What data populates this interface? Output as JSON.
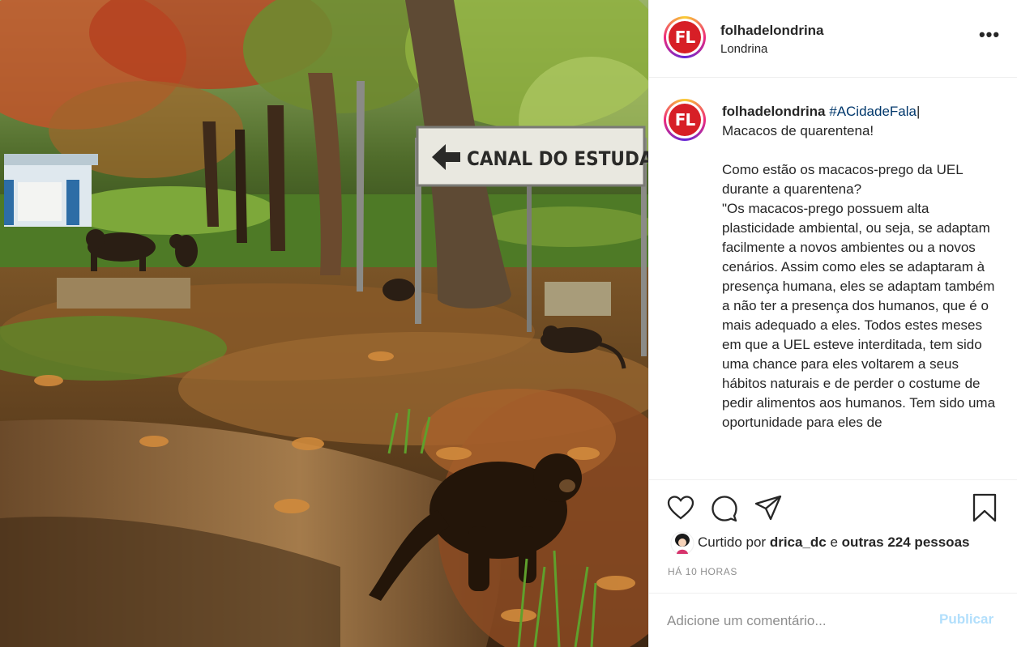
{
  "post": {
    "username": "folhadelondrina",
    "location": "Londrina",
    "avatar_text": "FL",
    "more_label": "•••"
  },
  "photo": {
    "sign_text": "CANAL DO ESTUDANTE"
  },
  "caption": {
    "username": "folhadelondrina",
    "hashtag": "#ACidadeFala",
    "cursor": "|",
    "text": "Macacos de quarentena!\n\nComo estão os macacos-prego da UEL durante a quarentena?\n\"Os macacos-prego possuem alta plasticidade ambiental, ou seja, se adaptam facilmente a novos ambientes ou a novos cenários. Assim como eles se adaptaram à presença humana, eles se adaptam também a não ter a presença dos humanos, que é o mais adequado a eles. Todos estes meses em que a UEL esteve interditada, tem sido uma chance para eles voltarem a seus hábitos naturais e de perder o costume de pedir alimentos aos humanos. Tem sido uma oportunidade para eles de"
  },
  "likes": {
    "prefix": "Curtido por ",
    "user": "drica_dc",
    "middle": " e ",
    "others": "outras 224 pessoas"
  },
  "timestamp": "HÁ 10 HORAS",
  "comment": {
    "placeholder": "Adicione um comentário...",
    "publish_label": "Publicar"
  },
  "icons": [
    "heart-icon",
    "comment-icon",
    "share-icon",
    "bookmark-icon",
    "more-icon"
  ],
  "colors": {
    "brand_red": "#d71f26",
    "hashtag": "#00376b",
    "publish_disabled": "#b2dffc",
    "muted": "#8e8e8e",
    "text": "#262626"
  }
}
